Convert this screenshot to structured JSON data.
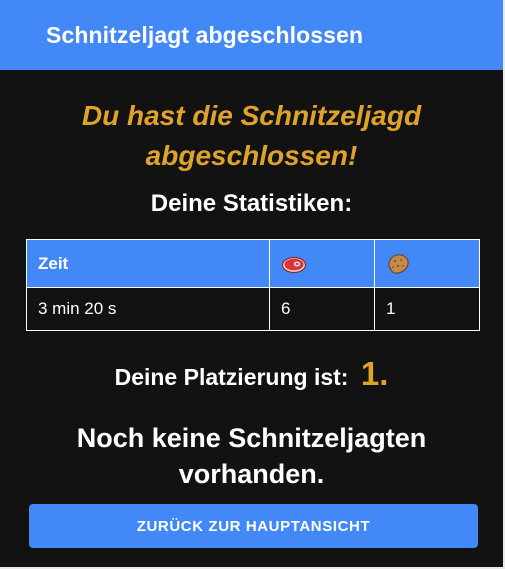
{
  "dialog": {
    "title": "Schnitzeljagt abgeschlossen"
  },
  "main": {
    "headline": "Du hast die Schnitzeljagd abgeschlossen!",
    "stats_title": "Deine Statistiken:",
    "stats_table": {
      "headers": {
        "time": "Zeit",
        "meat_icon": "meat-icon",
        "potato_icon": "potato-icon"
      },
      "row": {
        "time": "3 min 20 s",
        "meat": "6",
        "potato": "1"
      }
    },
    "placement_label": "Deine Platzierung ist:",
    "placement_value": "1.",
    "no_hunts_text": "Noch keine Schnitzeljagten vorhanden.",
    "back_button": "ZURÜCK ZUR HAUPTANSICHT"
  },
  "colors": {
    "accent": "#4288f6",
    "highlight": "#e0a32a",
    "background": "#121212"
  }
}
